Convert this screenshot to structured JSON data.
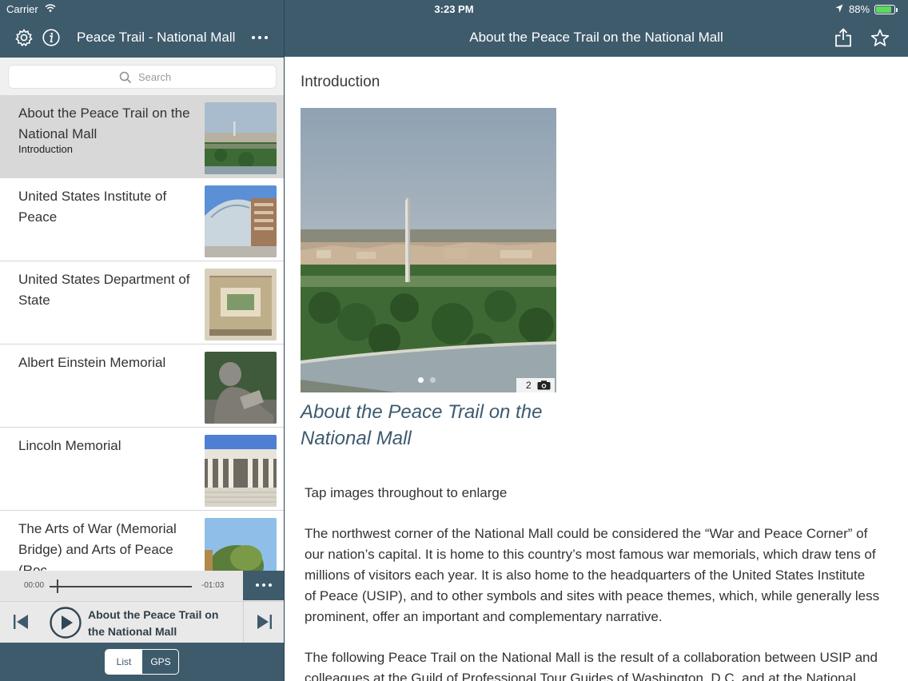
{
  "status": {
    "carrier": "Carrier",
    "time": "3:23 PM",
    "battery": "88%",
    "battery_level": 0.88
  },
  "sidebar": {
    "title": "Peace Trail - National Mall",
    "search_placeholder": "Search",
    "items": [
      {
        "title": "About the Peace Trail on the National Mall",
        "subtitle": "Introduction",
        "selected": true
      },
      {
        "title": "United States Institute of Peace",
        "subtitle": ""
      },
      {
        "title": "United States Department of State",
        "subtitle": ""
      },
      {
        "title": "Albert Einstein Memorial",
        "subtitle": ""
      },
      {
        "title": "Lincoln Memorial",
        "subtitle": ""
      },
      {
        "title": "The Arts of War (Memorial Bridge) and Arts of Peace (Roc…",
        "subtitle": ""
      }
    ]
  },
  "player": {
    "elapsed": "00:00",
    "remaining": "-01:03",
    "progress": 0.05,
    "track_title": "About the Peace Trail on the National Mall"
  },
  "segmented": {
    "options": [
      "List",
      "GPS"
    ],
    "selected": "List"
  },
  "detail": {
    "nav_title": "About the Peace Trail on the National Mall",
    "section_label": "Introduction",
    "photo_count": "2",
    "heading": "About the Peace Trail on the National Mall",
    "paragraphs": [
      "Tap images throughout to enlarge",
      "The northwest corner of the National Mall could be considered the “War and Peace Corner” of our nation’s capital. It is home to this country’s most famous war memorials, which draw tens of millions of visitors each year. It is also home to the headquarters of the United States Institute of Peace (USIP), and to other symbols and sites with peace themes, which, while generally less prominent, offer an important and complementary narrative.",
      "The following Peace Trail on the National Mall is the result of a collaboration between USIP and colleagues at the Guild of Professional Tour Guides of Washington, D.C. and at the National Park Service. At each stop, USIP"
    ]
  },
  "colors": {
    "nav_bar": "#3e5b6c",
    "heading": "#3c5b6e",
    "selected_row": "#d8d8d8"
  },
  "icons": [
    "wifi-icon",
    "location-arrow-icon",
    "battery-icon",
    "gear-icon",
    "info-icon",
    "more-icon",
    "search-icon",
    "share-icon",
    "star-icon",
    "play-icon",
    "skip-back-icon",
    "skip-forward-icon",
    "camera-icon"
  ]
}
